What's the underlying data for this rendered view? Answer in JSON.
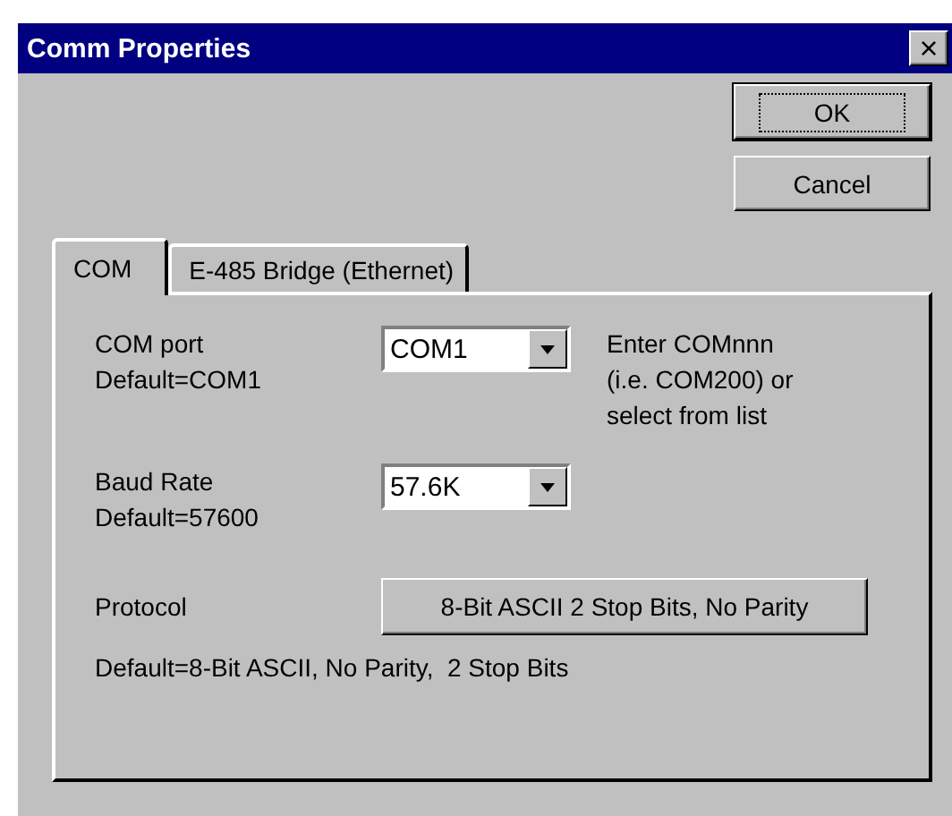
{
  "window": {
    "title": "Comm Properties",
    "close": "×"
  },
  "buttons": [
    {
      "label": "OK",
      "default": true
    },
    {
      "label": "Cancel",
      "default": false
    }
  ],
  "tabs": [
    {
      "label": "COM",
      "selected": true
    },
    {
      "label": "E-485 Bridge (Ethernet)",
      "selected": false
    }
  ],
  "com_port": {
    "label": "COM port",
    "default": "Default=COM1",
    "value": "COM1",
    "hint": [
      "Enter COMnnn",
      "(i.e. COM200) or",
      "select from list"
    ]
  },
  "baud_rate": {
    "label": "Baud Rate",
    "default": "Default=57600",
    "value": "57.6K"
  },
  "protocol": {
    "label": "Protocol",
    "button": "8-Bit ASCII 2 Stop Bits, No Parity",
    "default": "Default=8-Bit ASCII, No Parity,  2 Stop Bits"
  }
}
